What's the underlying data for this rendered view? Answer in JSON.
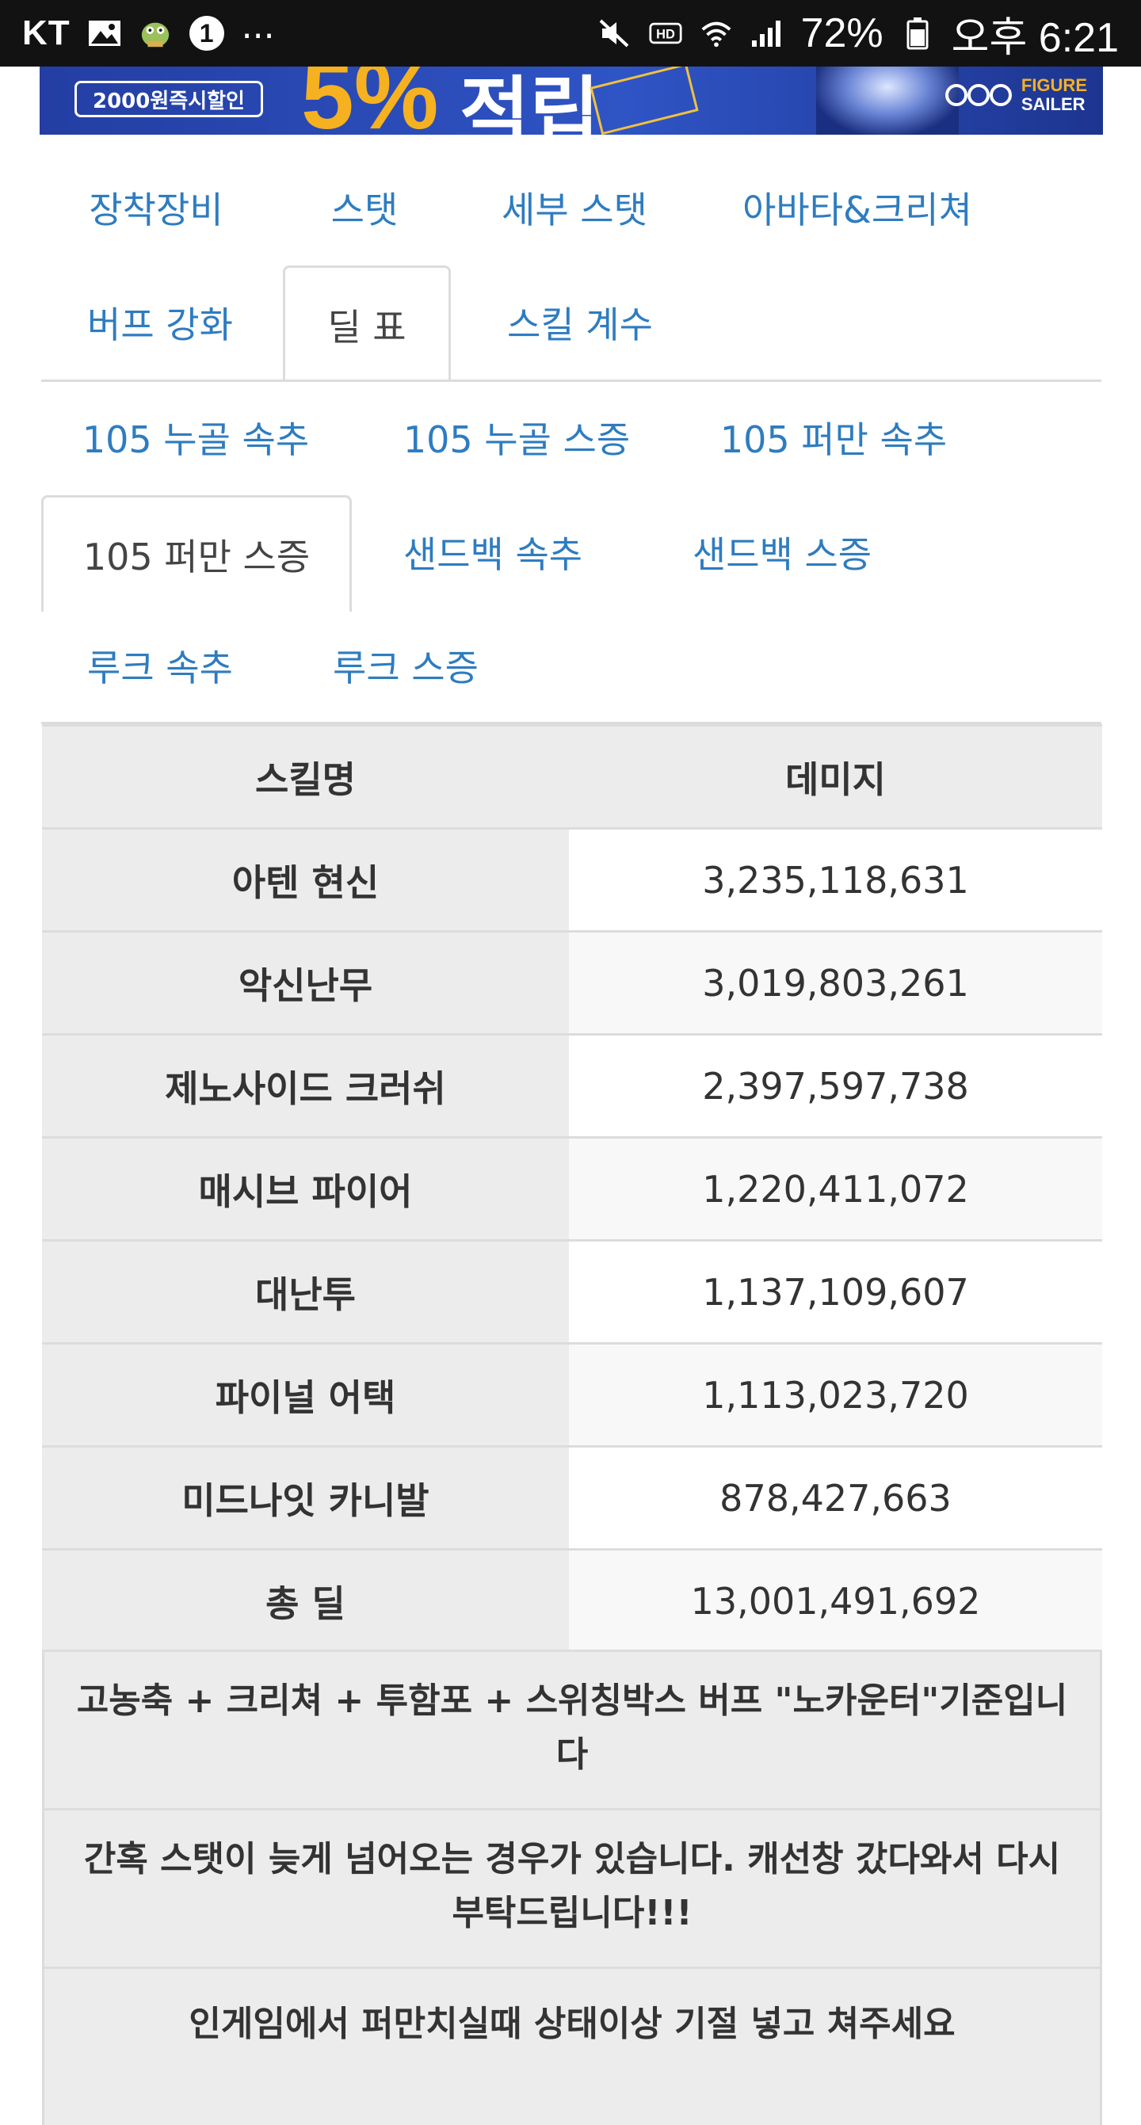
{
  "status_bar": {
    "carrier": "KT",
    "notification_badge": "1",
    "more": "...",
    "battery_percent": "72%",
    "time": "오후 6:21",
    "icons": [
      "image-icon",
      "app-notification-icon",
      "mute-icon",
      "hd-icon",
      "wifi-icon",
      "signal-icon",
      "battery-icon"
    ]
  },
  "banner": {
    "pill_text": "2000원즉시할인",
    "big_text": "5%",
    "big_text_2": "적립",
    "logo_text_1": "FIGURE",
    "logo_text_2": "SAILER"
  },
  "main_tabs": [
    {
      "label": "장착장비",
      "active": false
    },
    {
      "label": "스탯",
      "active": false
    },
    {
      "label": "세부 스탯",
      "active": false
    },
    {
      "label": "아바타&크리쳐",
      "active": false
    },
    {
      "label": "버프 강화",
      "active": false
    },
    {
      "label": "딜 표",
      "active": true
    },
    {
      "label": "스킬 계수",
      "active": false
    }
  ],
  "sub_tabs": [
    {
      "label": "105 누골 속추",
      "active": false
    },
    {
      "label": "105 누골 스증",
      "active": false
    },
    {
      "label": "105 퍼만 속추",
      "active": false
    },
    {
      "label": "105 퍼만 스증",
      "active": true
    },
    {
      "label": "샌드백 속추",
      "active": false
    },
    {
      "label": "샌드백 스증",
      "active": false
    },
    {
      "label": "루크 속추",
      "active": false
    },
    {
      "label": "루크 스증",
      "active": false
    }
  ],
  "table": {
    "headers": {
      "skill": "스킬명",
      "damage": "데미지"
    },
    "rows": [
      {
        "skill": "아텐 현신",
        "damage": "3,235,118,631"
      },
      {
        "skill": "악신난무",
        "damage": "3,019,803,261"
      },
      {
        "skill": "제노사이드 크러쉬",
        "damage": "2,397,597,738"
      },
      {
        "skill": "매시브 파이어",
        "damage": "1,220,411,072"
      },
      {
        "skill": "대난투",
        "damage": "1,137,109,607"
      },
      {
        "skill": "파이널 어택",
        "damage": "1,113,023,720"
      },
      {
        "skill": "미드나잇 카니발",
        "damage": "878,427,663"
      },
      {
        "skill": "총 딜",
        "damage": "13,001,491,692"
      }
    ]
  },
  "notes": [
    "고농축 + 크리쳐 + 투함포 + 스위칭박스 버프 \"노카운터\"기준입니다",
    "간혹 스탯이 늦게 넘어오는 경우가 있습니다. 캐선창 갔다와서 다시 부탁드립니다!!!",
    "인게임에서 퍼만치실때 상태이상 기절 넣고 쳐주세요"
  ]
}
